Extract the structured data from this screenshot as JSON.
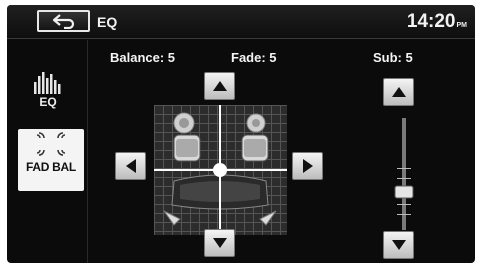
{
  "header": {
    "back_icon": "back-arrow-icon",
    "title": "EQ",
    "time": "14:20",
    "time_suffix": "PM"
  },
  "sidebar": {
    "eq_label": "EQ",
    "eq_icon": "equalizer-bars-icon",
    "fadbal_label": "FAD BAL",
    "fadbal_icon": "speakers-icon"
  },
  "readouts": {
    "balance": "Balance: 5",
    "fade": "Fade: 5",
    "sub": "Sub: 5"
  },
  "levels": {
    "balance": 5,
    "fade": 5,
    "sub": 5
  },
  "colors": {
    "background": "#0b0b0b",
    "text": "#f4f4f4",
    "button": "#e0e0e0",
    "crosshair": "#ffffff"
  }
}
